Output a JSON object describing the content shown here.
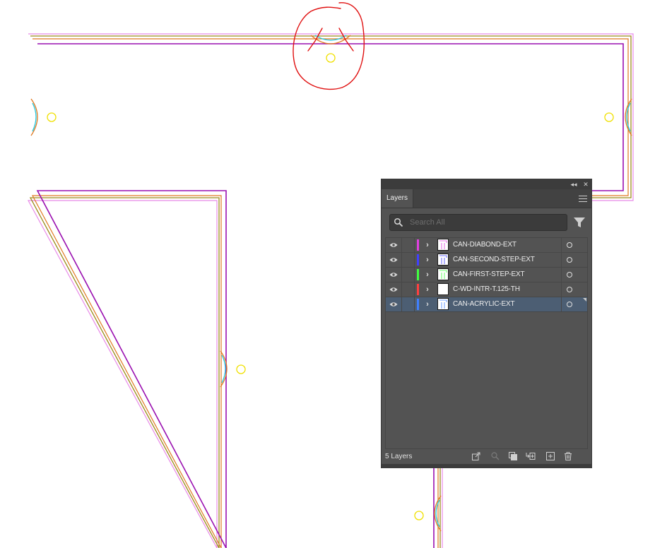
{
  "panel": {
    "tab_label": "Layers",
    "search_placeholder": "Search All",
    "layer_count": "5 Layers",
    "layers": [
      {
        "name": "CAN-DIABOND-EXT",
        "color": "#e040e0",
        "selected": false
      },
      {
        "name": "CAN-SECOND-STEP-EXT",
        "color": "#4040ff",
        "selected": false
      },
      {
        "name": "CAN-FIRST-STEP-EXT",
        "color": "#40ff40",
        "selected": false
      },
      {
        "name": "C-WD-INTR-T.125-TH",
        "color": "#ff4040",
        "selected": false
      },
      {
        "name": "CAN-ACRYLIC-EXT",
        "color": "#4080ff",
        "selected": true
      }
    ]
  },
  "icons": {
    "collapse": "double-chevron-left-icon",
    "close": "close-icon",
    "menu": "hamburger-menu-icon",
    "search": "search-icon",
    "filter": "funnel-icon",
    "visibility": "eye-icon",
    "expand": "chevron-right-icon",
    "target": "target-circle-icon",
    "footer": [
      "export-icon",
      "locate-object-icon",
      "clipping-mask-icon",
      "new-sublayer-icon",
      "new-layer-icon",
      "trash-icon"
    ]
  },
  "colors": {
    "panel_bg": "#535353",
    "selected_row": "#4c5e73",
    "outline_pink": "#e88ae8",
    "outline_olive": "#9a8a1a",
    "outline_orange": "#e07820",
    "outline_purple": "#9a10b0",
    "marker_yellow": "#f0e000",
    "annotation_red": "#e01010"
  }
}
